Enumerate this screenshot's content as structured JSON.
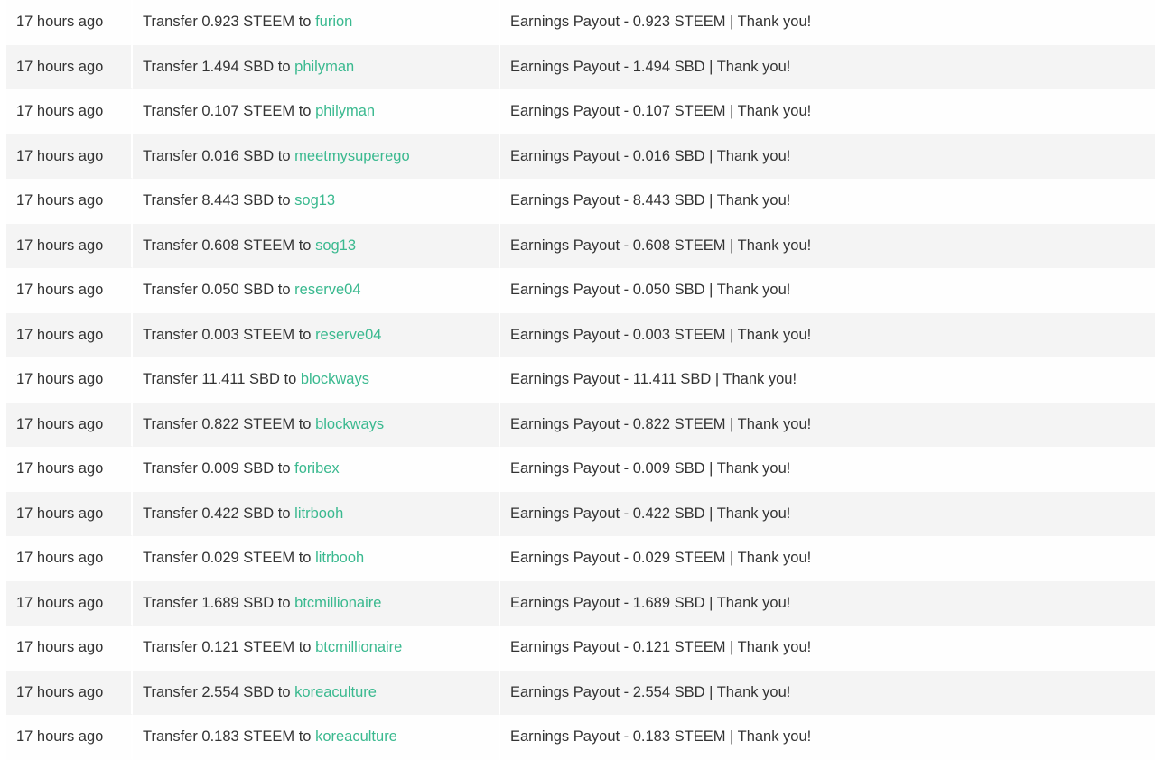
{
  "colors": {
    "link": "#3ab98f",
    "text": "#333333",
    "row_alt_bg": "#f4f4f4"
  },
  "transfers": [
    {
      "time": "17 hours ago",
      "op_prefix": "Transfer 0.923 STEEM to",
      "account": "furion",
      "memo": "Earnings Payout - 0.923 STEEM | Thank you!"
    },
    {
      "time": "17 hours ago",
      "op_prefix": "Transfer 1.494 SBD to",
      "account": "philyman",
      "memo": "Earnings Payout - 1.494 SBD | Thank you!"
    },
    {
      "time": "17 hours ago",
      "op_prefix": "Transfer 0.107 STEEM to",
      "account": "philyman",
      "memo": "Earnings Payout - 0.107 STEEM | Thank you!"
    },
    {
      "time": "17 hours ago",
      "op_prefix": "Transfer 0.016 SBD to",
      "account": "meetmysuperego",
      "memo": "Earnings Payout - 0.016 SBD | Thank you!"
    },
    {
      "time": "17 hours ago",
      "op_prefix": "Transfer 8.443 SBD to",
      "account": "sog13",
      "memo": "Earnings Payout - 8.443 SBD | Thank you!"
    },
    {
      "time": "17 hours ago",
      "op_prefix": "Transfer 0.608 STEEM to",
      "account": "sog13",
      "memo": "Earnings Payout - 0.608 STEEM | Thank you!"
    },
    {
      "time": "17 hours ago",
      "op_prefix": "Transfer 0.050 SBD to",
      "account": "reserve04",
      "memo": "Earnings Payout - 0.050 SBD | Thank you!"
    },
    {
      "time": "17 hours ago",
      "op_prefix": "Transfer 0.003 STEEM to",
      "account": "reserve04",
      "memo": "Earnings Payout - 0.003 STEEM | Thank you!"
    },
    {
      "time": "17 hours ago",
      "op_prefix": "Transfer 11.411 SBD to",
      "account": "blockways",
      "memo": "Earnings Payout - 11.411 SBD | Thank you!"
    },
    {
      "time": "17 hours ago",
      "op_prefix": "Transfer 0.822 STEEM to",
      "account": "blockways",
      "memo": "Earnings Payout - 0.822 STEEM | Thank you!"
    },
    {
      "time": "17 hours ago",
      "op_prefix": "Transfer 0.009 SBD to",
      "account": "foribex",
      "memo": "Earnings Payout - 0.009 SBD | Thank you!"
    },
    {
      "time": "17 hours ago",
      "op_prefix": "Transfer 0.422 SBD to",
      "account": "litrbooh",
      "memo": "Earnings Payout - 0.422 SBD | Thank you!"
    },
    {
      "time": "17 hours ago",
      "op_prefix": "Transfer 0.029 STEEM to",
      "account": "litrbooh",
      "memo": "Earnings Payout - 0.029 STEEM | Thank you!"
    },
    {
      "time": "17 hours ago",
      "op_prefix": "Transfer 1.689 SBD to",
      "account": "btcmillionaire",
      "memo": "Earnings Payout - 1.689 SBD | Thank you!"
    },
    {
      "time": "17 hours ago",
      "op_prefix": "Transfer 0.121 STEEM to",
      "account": "btcmillionaire",
      "memo": "Earnings Payout - 0.121 STEEM | Thank you!"
    },
    {
      "time": "17 hours ago",
      "op_prefix": "Transfer 2.554 SBD to",
      "account": "koreaculture",
      "memo": "Earnings Payout - 2.554 SBD | Thank you!"
    },
    {
      "time": "17 hours ago",
      "op_prefix": "Transfer 0.183 STEEM to",
      "account": "koreaculture",
      "memo": "Earnings Payout - 0.183 STEEM | Thank you!"
    }
  ]
}
